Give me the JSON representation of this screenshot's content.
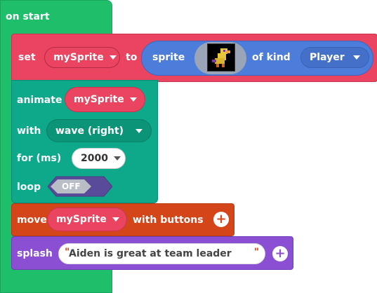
{
  "on_start": {
    "label": "on start"
  },
  "set_block": {
    "set_label": "set",
    "variable": "mySprite",
    "to_label": "to",
    "sprite_label": "sprite",
    "of_kind_label": "of kind",
    "kind_value": "Player"
  },
  "animate_block": {
    "animate_label": "animate",
    "variable": "mySprite",
    "with_label": "with",
    "animation_value": "wave (right)",
    "for_label": "for (ms)",
    "duration_value": "2000",
    "loop_label": "loop",
    "loop_state": "OFF"
  },
  "move_block": {
    "move_label": "move",
    "variable": "mySprite",
    "with_buttons_label": "with buttons"
  },
  "splash_block": {
    "splash_label": "splash",
    "open_quote": "\"",
    "text_value": "Aiden is great at team leader",
    "close_quote": "\""
  },
  "colors": {
    "hat_green": "#1fbe6b",
    "sprites_red": "#ea4460",
    "sprite_blue": "#4c7ddb",
    "animation_teal": "#0ea88a",
    "controller_orange": "#d5451a",
    "game_purple": "#8a4fd3"
  }
}
